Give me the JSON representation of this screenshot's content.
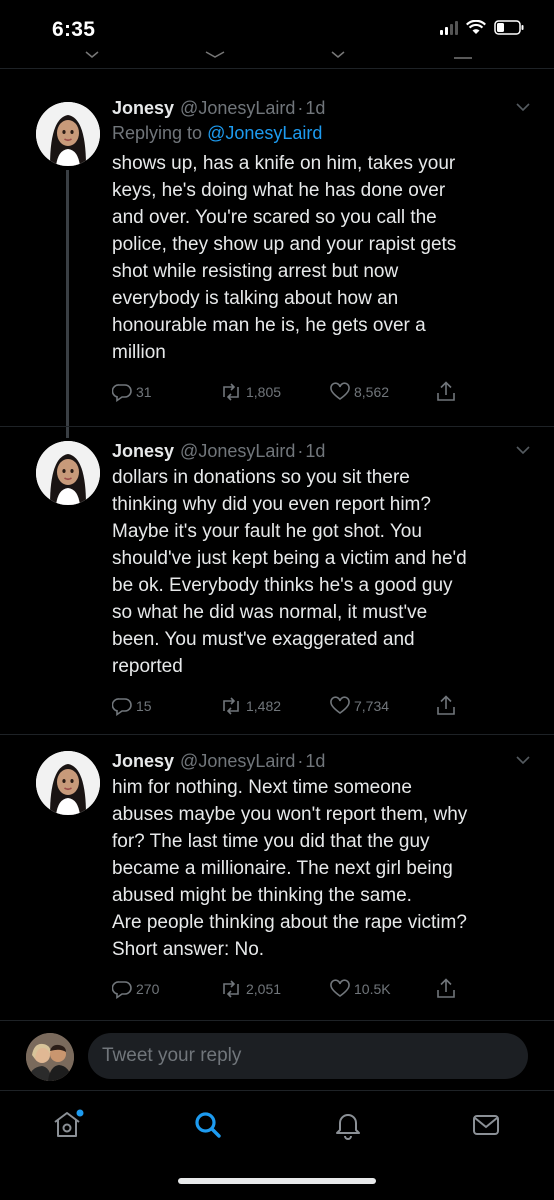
{
  "status_bar": {
    "time": "6:35"
  },
  "tweets": [
    {
      "name": "Jonesy",
      "handle": "@JonesyLaird",
      "separator": "·",
      "age": "1d",
      "replying_prefix": "Replying to",
      "replying_handle": "@JonesyLaird",
      "text": "shows up, has a knife on him, takes your\nkeys, he's doing what he has done over\nand over. You're scared so you call the\npolice, they show up and your rapist gets\nshot while resisting arrest but now\neverybody is talking about how an\nhonourable man he is, he gets over a\nmillion",
      "replies": "31",
      "retweets": "1,805",
      "likes": "8,562"
    },
    {
      "name": "Jonesy",
      "handle": "@JonesyLaird",
      "separator": "·",
      "age": "1d",
      "text": "dollars in donations so you sit there\nthinking why did you even report him?\nMaybe it's your fault he got shot. You\nshould've just kept being a victim and he'd\nbe ok. Everybody thinks he's a good guy\nso what he did was normal, it must've\nbeen. You must've exaggerated and\nreported",
      "replies": "15",
      "retweets": "1,482",
      "likes": "7,734"
    },
    {
      "name": "Jonesy",
      "handle": "@JonesyLaird",
      "separator": "·",
      "age": "1d",
      "text": "him for nothing. Next time someone\nabuses maybe you won't report them, why\nfor? The last time you did that the guy\nbecame a millionaire. The next girl being\nabused might be thinking the same.\nAre people thinking about the rape victim?\nShort answer: No.",
      "replies": "270",
      "retweets": "2,051",
      "likes": "10.5K"
    }
  ],
  "reply_bar": {
    "placeholder": "Tweet your reply"
  },
  "tab_bar": {
    "items": [
      "home-icon",
      "search-icon",
      "notifications-icon",
      "messages-icon"
    ],
    "active": "search-icon"
  },
  "colors": {
    "background": "#000000",
    "text": "#e7e9ea",
    "secondary": "#71767b",
    "accent": "#1d9bf0",
    "divider": "#1e2226"
  }
}
